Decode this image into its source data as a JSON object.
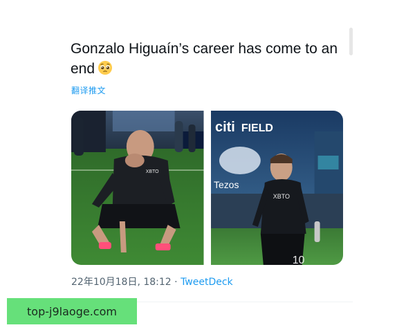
{
  "tweet": {
    "text": "Gonzalo Higuaín’s career has come to an end",
    "emoji": "pleading-face-emoji",
    "translate_label": "翻译推文",
    "photos": [
      {
        "name": "kneeling-player-photo",
        "jersey_text": "XBTO"
      },
      {
        "name": "walking-player-photo",
        "sign_text": "citi FIELD",
        "jersey_text": "XBTO",
        "number": "10",
        "banner_text": "Tezos"
      }
    ],
    "timestamp": "22年10月18日, 18:12",
    "separator": " · ",
    "source": "TweetDeck"
  },
  "watermark": {
    "text": "top-j9laoge.com"
  },
  "colors": {
    "text": "#0f1419",
    "link": "#1d9bf0",
    "muted": "#536471",
    "watermark_bg": "#66e07a"
  }
}
